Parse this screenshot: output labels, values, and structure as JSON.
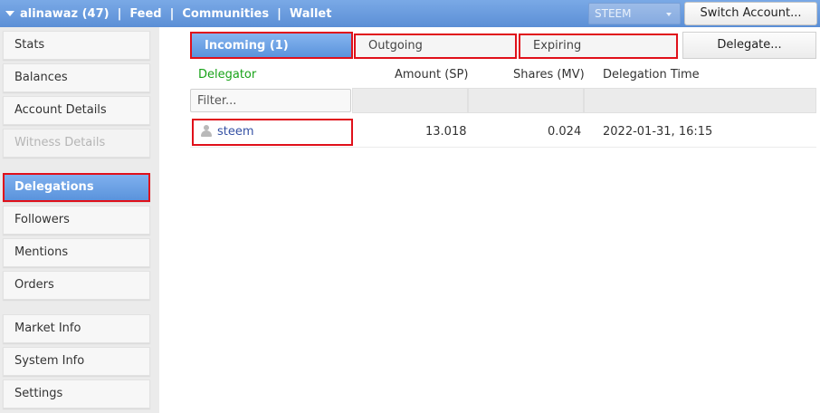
{
  "topbar": {
    "account": "alinawaz (47)",
    "links": [
      "Feed",
      "Communities",
      "Wallet"
    ],
    "separator": "|",
    "coin_select": "STEEM",
    "switch_account": "Switch Account..."
  },
  "sidebar": {
    "items": [
      {
        "label": "Stats"
      },
      {
        "label": "Balances"
      },
      {
        "label": "Account Details"
      },
      {
        "label": "Witness Details"
      },
      {
        "label": "Delegations"
      },
      {
        "label": "Followers"
      },
      {
        "label": "Mentions"
      },
      {
        "label": "Orders"
      },
      {
        "label": "Market Info"
      },
      {
        "label": "System Info"
      },
      {
        "label": "Settings"
      }
    ]
  },
  "tabs": {
    "incoming": "Incoming (1)",
    "outgoing": "Outgoing",
    "expiring": "Expiring",
    "delegate_button": "Delegate..."
  },
  "table": {
    "headers": {
      "delegator": "Delegator",
      "amount": "Amount (SP)",
      "shares": "Shares (MV)",
      "time": "Delegation Time"
    },
    "filter_placeholder": "Filter...",
    "rows": [
      {
        "delegator": "steem",
        "amount": "13.018",
        "shares": "0.024",
        "time": "2022-01-31, 16:15"
      }
    ]
  },
  "colors": {
    "accent": "#5a93dc",
    "highlight": "#e0101a",
    "delegator_header": "#19a319",
    "link": "#3551a4"
  }
}
